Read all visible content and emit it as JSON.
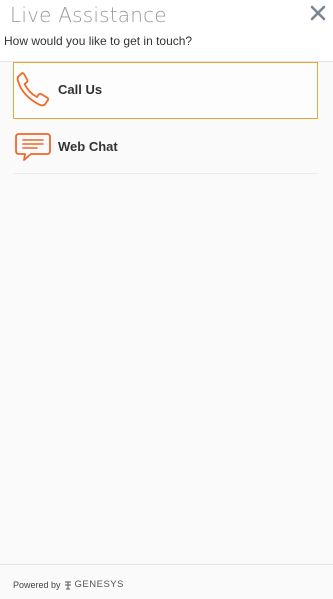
{
  "header": {
    "title": "Live Assistance",
    "subtitle": "How would you like to get in touch?",
    "close_icon": "close-icon"
  },
  "options": [
    {
      "label": "Call Us",
      "icon": "phone-icon",
      "active": true
    },
    {
      "label": "Web Chat",
      "icon": "chat-icon",
      "active": false
    }
  ],
  "footer": {
    "powered_by": "Powered by",
    "brand": "GENESYS",
    "brand_icon": "genesys-logo-icon"
  },
  "colors": {
    "accent": "#f0672a",
    "active_border": "#f0a33a",
    "close": "#7a8591"
  }
}
